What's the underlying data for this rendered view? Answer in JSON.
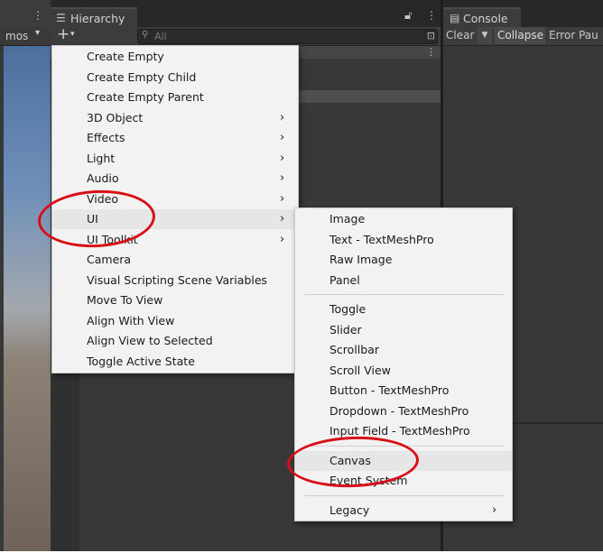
{
  "scene": {
    "gizmos_label": "mos",
    "icons": {
      "kebab": "kebab-menu-icon",
      "caret": "dropdown-caret-icon"
    }
  },
  "hierarchy": {
    "title": "Hierarchy",
    "search_placeholder": "All",
    "icons": {
      "tab": "hierarchy-list-icon",
      "lock": "lock-icon",
      "kebab": "kebab-menu-icon",
      "add": "plus-icon",
      "search": "search-icon"
    }
  },
  "console": {
    "title": "Console",
    "clear_label": "Clear",
    "collapse_label": "Collapse",
    "error_pause_label": "Error Pau",
    "icons": {
      "tab": "console-icon"
    }
  },
  "context_menu": {
    "items": [
      {
        "label": "Create Empty",
        "has_submenu": false
      },
      {
        "label": "Create Empty Child",
        "has_submenu": false
      },
      {
        "label": "Create Empty Parent",
        "has_submenu": false
      },
      {
        "label": "3D Object",
        "has_submenu": true
      },
      {
        "label": "Effects",
        "has_submenu": true
      },
      {
        "label": "Light",
        "has_submenu": true
      },
      {
        "label": "Audio",
        "has_submenu": true
      },
      {
        "label": "Video",
        "has_submenu": true
      },
      {
        "label": "UI",
        "has_submenu": true,
        "highlighted": true
      },
      {
        "label": "UI Toolkit",
        "has_submenu": true
      },
      {
        "label": "Camera",
        "has_submenu": false
      },
      {
        "label": "Visual Scripting Scene Variables",
        "has_submenu": false
      },
      {
        "label": "Move To View",
        "has_submenu": false
      },
      {
        "label": "Align With View",
        "has_submenu": false
      },
      {
        "label": "Align View to Selected",
        "has_submenu": false
      },
      {
        "label": "Toggle Active State",
        "has_submenu": false
      }
    ]
  },
  "ui_submenu": {
    "groups": [
      [
        "Image",
        "Text - TextMeshPro",
        "Raw Image",
        "Panel"
      ],
      [
        "Toggle",
        "Slider",
        "Scrollbar",
        "Scroll View",
        "Button - TextMeshPro",
        "Dropdown - TextMeshPro",
        "Input Field - TextMeshPro"
      ],
      [
        "Canvas",
        "Event System"
      ],
      [
        "Legacy"
      ]
    ],
    "highlighted": "Canvas",
    "has_submenu": [
      "Legacy"
    ]
  },
  "annotations": {
    "color": "#d80f16",
    "circled_items": [
      "UI",
      "Canvas"
    ]
  },
  "colors": {
    "panel_bg": "#383838",
    "menu_bg": "#f2f2f2",
    "menu_highlight": "#e6e6e6"
  }
}
